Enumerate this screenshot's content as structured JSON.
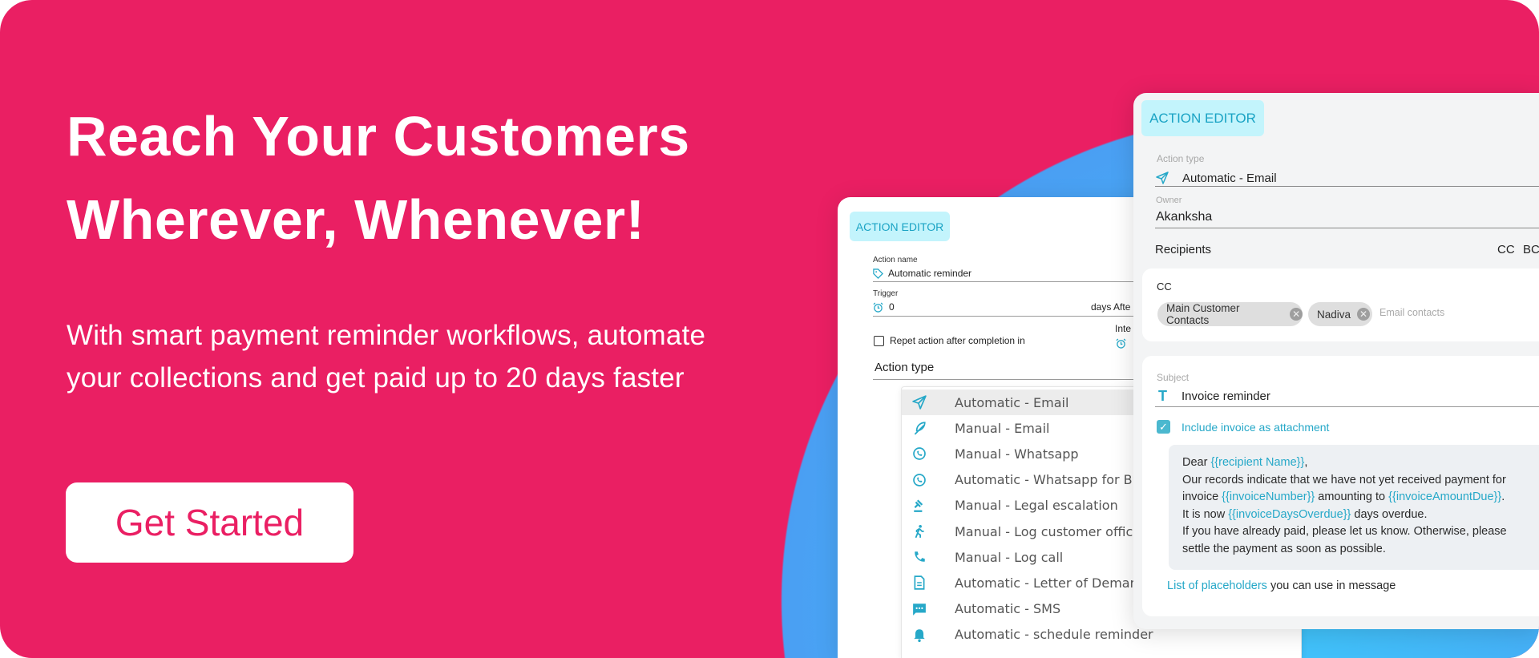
{
  "hero": {
    "headline_1": "Reach Your Customers",
    "headline_2": "Wherever, Whenever!",
    "subtitle_1": "With smart payment reminder workflows, automate",
    "subtitle_2": "your collections and get paid up to 20 days faster",
    "cta": "Get Started"
  },
  "colors": {
    "brand": "#EA1F63",
    "accent": "#26a8c8",
    "circle": "#3fc6fb"
  },
  "editor1": {
    "badge": "ACTION EDITOR",
    "action_name_label": "Action name",
    "action_name": "Automatic reminder",
    "trigger_label": "Trigger",
    "trigger_value": "0",
    "trigger_unit": "days Afte",
    "repeat_label": "Repet action after completion in",
    "interval_label": "Inte",
    "action_type_label": "Action type",
    "options": [
      {
        "label": "Automatic - Email",
        "icon": "send-icon"
      },
      {
        "label": "Manual - Email",
        "icon": "feather-icon"
      },
      {
        "label": "Manual - Whatsapp",
        "icon": "whatsapp-icon"
      },
      {
        "label": "Automatic - Whatsapp for Busi",
        "icon": "whatsapp-icon"
      },
      {
        "label": "Manual - Legal escalation",
        "icon": "gavel-icon"
      },
      {
        "label": "Manual - Log customer office v",
        "icon": "walk-icon"
      },
      {
        "label": "Manual - Log call",
        "icon": "phone-icon"
      },
      {
        "label": "Automatic - Letter of Demand",
        "icon": "document-icon"
      },
      {
        "label": "Automatic - SMS",
        "icon": "sms-icon"
      },
      {
        "label": "Automatic - schedule reminder",
        "icon": "bell-icon"
      }
    ]
  },
  "editor2": {
    "badge": "ACTION EDITOR",
    "action_type_label": "Action type",
    "action_type": "Automatic - Email",
    "owner_label": "Owner",
    "owner": "Akanksha",
    "recipients_label": "Recipients",
    "cc_toggle": "CC",
    "bcc_toggle": "BC",
    "cc_label": "CC",
    "chips": [
      "Main Customer Contacts",
      "Nadiva"
    ],
    "email_placeholder": "Email contacts",
    "subject_label": "Subject",
    "subject": "Invoice reminder",
    "attach_label": "Include invoice as attachment",
    "attach_checked": true,
    "message": {
      "dear": "Dear ",
      "p_recipient": "{{recipient Name}}",
      "comma": ",",
      "line2": "Our records indicate that we have not yet received payment for",
      "invoice": "invoice ",
      "p_number": "{{invoiceNumber}}",
      "amounting": " amounting to ",
      "p_amount": "{{invoiceAmountDue}}",
      "dot": ".",
      "itis": "It is now ",
      "p_days": "{{invoiceDaysOverdue}}",
      "overdue": " days overdue.",
      "line5": "If you have already paid, please let us know. Otherwise, please",
      "line6": "settle the payment as soon as possible."
    },
    "placeholders_link": "List of placeholders",
    "placeholders_rest": " you can use in message"
  }
}
